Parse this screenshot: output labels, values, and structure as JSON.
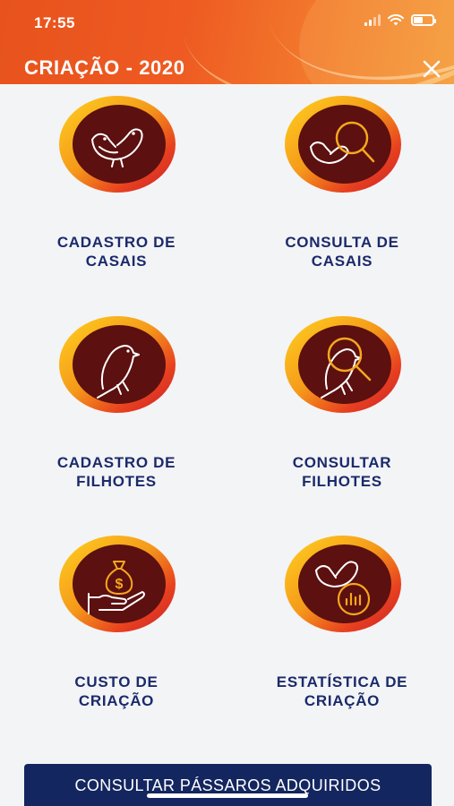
{
  "status_bar": {
    "time": "17:55"
  },
  "header": {
    "title": "CRIAÇÃO - 2020"
  },
  "tiles": [
    {
      "label": "CADASTRO DE\nCASAIS",
      "icon": "bird-pair-icon"
    },
    {
      "label": "CONSULTA DE\nCASAIS",
      "icon": "bird-pair-search-icon"
    },
    {
      "label": "CADASTRO DE\nFILHOTES",
      "icon": "bird-icon"
    },
    {
      "label": "CONSULTAR\nFILHOTES",
      "icon": "bird-search-icon"
    },
    {
      "label": "CUSTO DE\nCRIAÇÃO",
      "icon": "money-bag-hand-icon"
    },
    {
      "label": "ESTATÍSTICA DE\nCRIAÇÃO",
      "icon": "bird-pair-chart-icon"
    }
  ],
  "footer": {
    "button_label": "CONSULTAR PÁSSAROS ADQUIRIDOS"
  },
  "colors": {
    "header": "#e8531d",
    "medallion_inner": "#5c1010",
    "medallion_ring": "#f5a81c",
    "label": "#1b2a6b",
    "bottom_button": "#13265f"
  }
}
